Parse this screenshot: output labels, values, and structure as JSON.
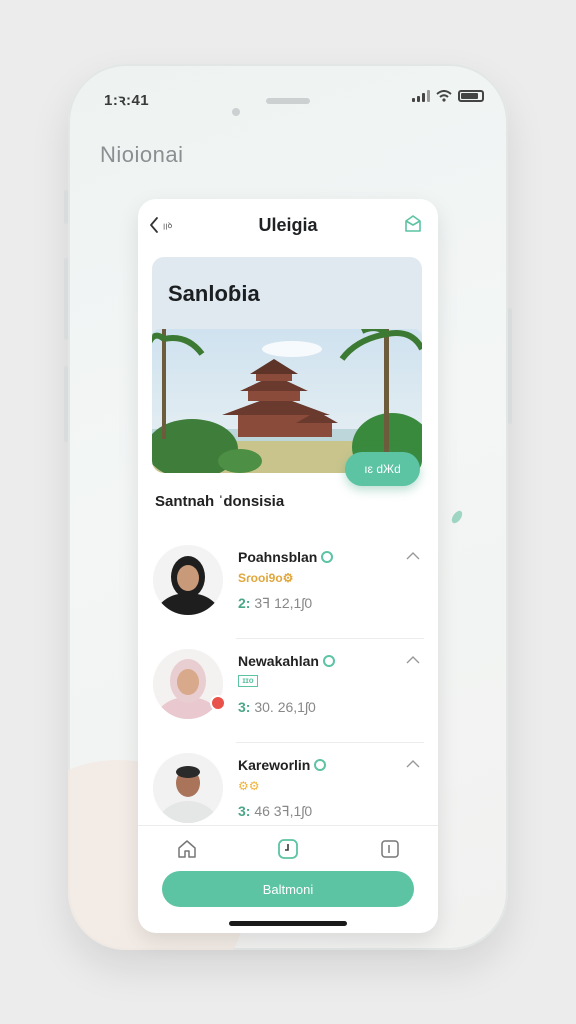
{
  "status_bar": {
    "time": "1:ꝛ:41"
  },
  "background": {
    "title": "Nioionai"
  },
  "screen": {
    "back_label": "ꞁꞁꝺ",
    "title": "Uleigia",
    "hero": {
      "title": "Sanloɓia",
      "button_label": "ıɛ dЖd"
    },
    "section_title": "Santnah ˈdonsisia",
    "list": [
      {
        "name": "Poahnsblan",
        "tag": "Sɾooi9o⚙",
        "meta_prefix": "2:",
        "meta_rest": "3ꟻ 12,1ʃ0"
      },
      {
        "name": "Newakahlan",
        "tag": "ɪɪo",
        "meta_prefix": "3:",
        "meta_rest": "30. 26,1ʃ0"
      },
      {
        "name": "Kareworlin",
        "tag": "⚙⚙",
        "meta_prefix": "3:",
        "meta_rest": "46 3ꟻ,1ʃ0"
      }
    ],
    "primary_button": "Baltmoni"
  },
  "colors": {
    "accent": "#5cc3a3",
    "badge": "#e9524a"
  },
  "icons": [
    "back-icon",
    "gift-icon",
    "home-icon",
    "clock-icon",
    "document-icon",
    "chevron-up-icon",
    "verified-icon"
  ]
}
